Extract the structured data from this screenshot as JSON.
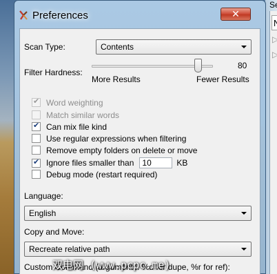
{
  "window": {
    "title": "Preferences",
    "close_symbol": "✕",
    "colors": {
      "frame": "#a6c4e0",
      "close": "#c8432c",
      "check": "#1c3e7a"
    }
  },
  "background_window": {
    "title_fragment": "Se",
    "field_fragment": "N",
    "placeholder_fragment_1": "▷",
    "placeholder_fragment_2": "▷"
  },
  "scan_type": {
    "label": "Scan Type:",
    "value": "Contents"
  },
  "filter_hardness": {
    "label": "Filter Hardness:",
    "value": "80",
    "level": 80,
    "min_label": "More Results",
    "max_label": "Fewer Results"
  },
  "options": [
    {
      "label": "Word weighting",
      "checked": true,
      "enabled": false
    },
    {
      "label": "Match similar words",
      "checked": false,
      "enabled": false
    },
    {
      "label": "Can mix file kind",
      "checked": true,
      "enabled": true
    },
    {
      "label": "Use regular expressions when filtering",
      "checked": false,
      "enabled": true
    },
    {
      "label": "Remove empty folders on delete or move",
      "checked": false,
      "enabled": true
    },
    {
      "label": "Ignore files smaller than",
      "checked": true,
      "enabled": true
    },
    {
      "label": "Debug mode (restart required)",
      "checked": false,
      "enabled": true
    }
  ],
  "min_size": {
    "value": "10",
    "unit": "KB"
  },
  "language": {
    "label": "Language:",
    "value": "English"
  },
  "copy_move": {
    "label": "Copy and Move:",
    "value": "Recreate relative path"
  },
  "custom_command": {
    "label": "Custom Command (arguments: %d for dupe, %r for ref):"
  },
  "watermark": {
    "text": "双电网 (www.pcpc.me)"
  }
}
